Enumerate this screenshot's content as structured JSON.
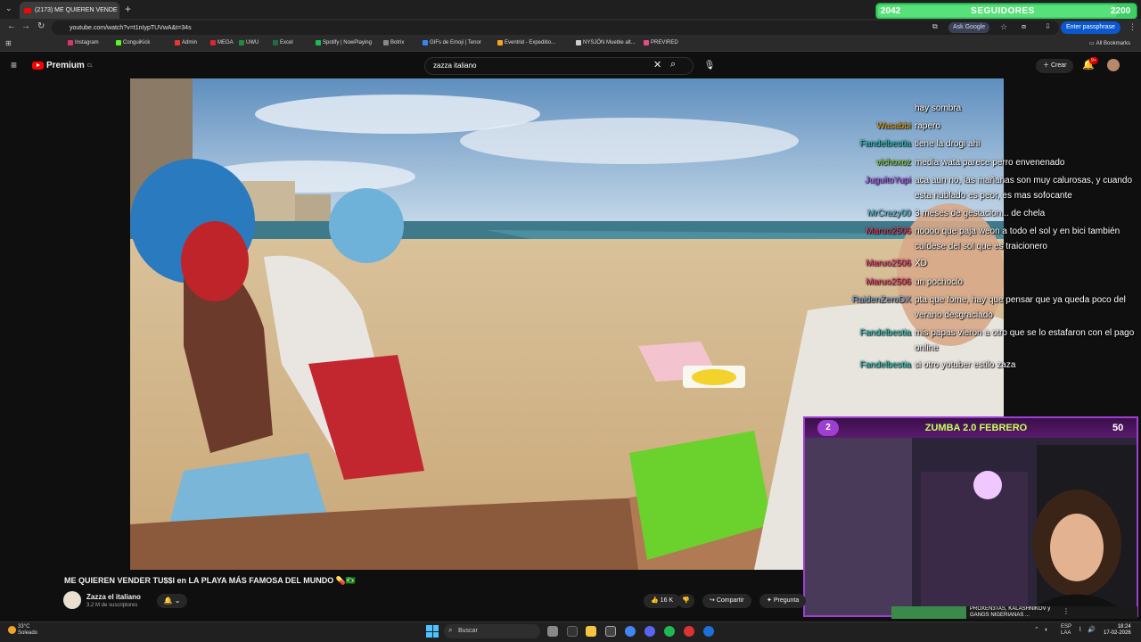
{
  "browser": {
    "tab_title": "(2173) ME QUIEREN VENDE",
    "url": "youtube.com/watch?v=t1nIypTUVwA&t=34s",
    "ask_google": "Ask Google",
    "passphrase": "Enter passphrase",
    "all_bookmarks": "All Bookmarks",
    "bookmarks": [
      {
        "label": "Instagram",
        "color": "#e1306c"
      },
      {
        "label": "ConguiKick",
        "color": "#53fc18"
      },
      {
        "label": "Admin",
        "color": "#e33"
      },
      {
        "label": "MEGA",
        "color": "#d9272e"
      },
      {
        "label": "UWU",
        "color": "#1e8e3e"
      },
      {
        "label": "Excel",
        "color": "#1d6f42"
      },
      {
        "label": "Spotify | NowPlaying",
        "color": "#1db954"
      },
      {
        "label": "Botrix",
        "color": "#888"
      },
      {
        "label": "GIFs de Emoji | Tenor",
        "color": "#3b82f6"
      },
      {
        "label": "Eventrid - Expeditio...",
        "color": "#f5a623"
      },
      {
        "label": "NYSJÖN Mueble alt...",
        "color": "#ccc"
      },
      {
        "label": "PREVIRED",
        "color": "#e94b8a"
      }
    ]
  },
  "follower_goal": {
    "current": "2042",
    "title": "SEGUIDORES",
    "goal": "2200",
    "progress": 0.93
  },
  "youtube": {
    "brand": "Premium",
    "region": "CL",
    "search_value": "zazza italiano",
    "create": "Crear",
    "notif_count": "9+",
    "video_title": "ME QUIEREN VENDER TU$$I en LA PLAYA MÁS FAMOSA DEL MUNDO 💊🇧🇷",
    "channel_name": "Zazza el italiano",
    "channel_subs": "3,2 M de suscriptores",
    "likes": "16 K",
    "share": "Compartir",
    "ask": "Pregunta"
  },
  "chat": [
    {
      "name": "",
      "color": "#fff",
      "msg": "hay sombra"
    },
    {
      "name": "Wasabbi",
      "color": "#e8a317",
      "msg": "rapero"
    },
    {
      "name": "Fandelbestia",
      "color": "#26c6b9",
      "msg": "tiene la drogi ahi"
    },
    {
      "name": "vichoxoz",
      "color": "#7ed321",
      "msg": "media wata parece perro envenenado"
    },
    {
      "name": "JuguitoYupi",
      "color": "#b052ff",
      "msg": "aca aun no, las mañanas son muy calurosas, y cuando esta nublado es peor, es mas sofocante"
    },
    {
      "name": "MrCrazy00",
      "color": "#5bc0de",
      "msg": "3 meses de gestacion... de chela"
    },
    {
      "name": "Maruo2506",
      "color": "#ff3d6e",
      "msg": "noooo que paja weon a todo el sol y en bici también cuídese del sol que es traicionero"
    },
    {
      "name": "Maruo2506",
      "color": "#ff3d6e",
      "msg": "XD"
    },
    {
      "name": "Maruo2506",
      "color": "#ff3d6e",
      "msg": "un pochoclo"
    },
    {
      "name": "RaidenZeroDX",
      "color": "#78a9e8",
      "msg": "pta que fome, hay que pensar que ya queda poco del verano desgraciado"
    },
    {
      "name": "Fandelbestia",
      "color": "#26c6b9",
      "msg": "mis papas vieron a otro que se lo estafaron con el pago online"
    },
    {
      "name": "Fandelbestia",
      "color": "#26c6b9",
      "msg": "si otro yotuber estilo zaza"
    }
  ],
  "zumba_goal": {
    "current": "2",
    "title": "ZUMBA 2.0 FEBRERO",
    "goal": "50"
  },
  "ticker": {
    "line1": "PROXEN3TAS, KALÁSHNIKOV y",
    "line2": "GANGS NIGERIANAS ..."
  },
  "taskbar": {
    "temp": "33°C",
    "weather": "Soleado",
    "search": "Buscar",
    "lang1": "ESP",
    "lang2": "LAA",
    "time": "18:24",
    "date": "17-02-2026"
  }
}
